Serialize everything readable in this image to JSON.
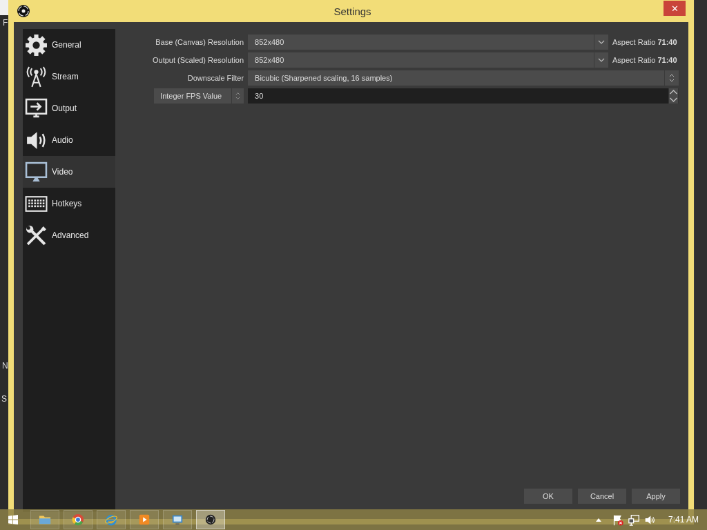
{
  "background_app": {
    "left_texts": [
      "F",
      "N",
      "S"
    ]
  },
  "window": {
    "title": "Settings",
    "close_glyph": "✕"
  },
  "sidebar": {
    "items": [
      {
        "label": "General",
        "selected": false
      },
      {
        "label": "Stream",
        "selected": false
      },
      {
        "label": "Output",
        "selected": false
      },
      {
        "label": "Audio",
        "selected": false
      },
      {
        "label": "Video",
        "selected": true
      },
      {
        "label": "Hotkeys",
        "selected": false
      },
      {
        "label": "Advanced",
        "selected": false
      }
    ]
  },
  "form": {
    "rows": [
      {
        "kind": "combo",
        "label": "Base (Canvas) Resolution",
        "value": "852x480",
        "note": "Aspect Ratio **71:40**"
      },
      {
        "kind": "combo",
        "label": "Output (Scaled) Resolution",
        "value": "852x480",
        "note": "Aspect Ratio **71:40**"
      },
      {
        "kind": "select",
        "label": "Downscale Filter",
        "value": "Bicubic (Sharpened scaling, 16 samples)"
      },
      {
        "kind": "spin",
        "label": "Integer FPS Value",
        "value": "30"
      }
    ]
  },
  "buttons": [
    "OK",
    "Cancel",
    "Apply"
  ],
  "taskbar": {
    "apps": [
      {
        "selected": false
      },
      {
        "selected": false
      },
      {
        "selected": false
      },
      {
        "selected": false
      },
      {
        "selected": false
      },
      {
        "selected": true
      }
    ],
    "clock": "7:41 AM"
  }
}
